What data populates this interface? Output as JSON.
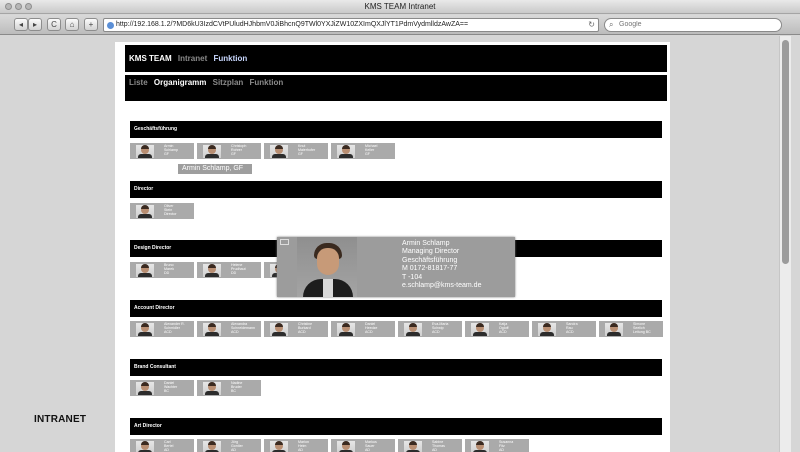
{
  "window": {
    "title": "KMS TEAM Intranet"
  },
  "toolbar": {
    "back": "◂",
    "forward": "▸",
    "reload": "C",
    "home": "⌂",
    "add": "+",
    "url": "http://192.168.1.2/?MD6kU3IzdCVtPUludHJhbmV0JiBhcnQ9TWl0YXJiZW10ZXImQXJlYT1PdmVydmlldzAwZA==",
    "search_placeholder": "Google"
  },
  "nav": {
    "brand": "KMS TEAM",
    "items": [
      "Intranet",
      "Funktion"
    ],
    "subitems": [
      "Liste",
      "Organigramm",
      "Sitzplan",
      "Funktion"
    ]
  },
  "sections": {
    "gf": "Geschäftsführung",
    "director": "Director",
    "design": "Design Director",
    "account": "Account Director",
    "brand": "Brand Consultant",
    "art": "Art Director"
  },
  "cards": {
    "gf": [
      [
        "Armin",
        "Schlamp",
        "GF"
      ],
      [
        "Christoph",
        "Rohrer",
        "GF"
      ],
      [
        "Knut",
        "Maierhofer",
        "GF"
      ],
      [
        "Michael",
        "Keller",
        "GF"
      ]
    ],
    "director": [
      [
        "Oliver",
        "Stein",
        "Director"
      ]
    ],
    "design": [
      [
        "Bruno",
        "Marek",
        "DD"
      ],
      [
        "Helene",
        "Prudhaut",
        "DD"
      ],
      [
        "",
        "",
        ""
      ],
      [
        "",
        "",
        ""
      ]
    ],
    "account": [
      [
        "Alexander R.",
        "Schmidler",
        "ACD"
      ],
      [
        "Alexandra",
        "Schneidemann",
        "ACD"
      ],
      [
        "Christine",
        "Burkard",
        "ACD"
      ],
      [
        "Daniel",
        "Heedze",
        "ACD"
      ],
      [
        "Eva-Maria",
        "Schwip",
        "ACD"
      ],
      [
        "Katja",
        "Ogloff",
        "ACD"
      ],
      [
        "Sandra",
        "Rau",
        "ACD"
      ],
      [
        "Simone",
        "Seelich",
        "Leitung BC"
      ]
    ],
    "brand": [
      [
        "Daniel",
        "Wachter",
        "BC"
      ],
      [
        "Nadine",
        "Bruder",
        "BC"
      ]
    ],
    "art": [
      [
        "Carl",
        "Bertel",
        "AD"
      ],
      [
        "Jörg",
        "Gontier",
        "AD"
      ],
      [
        "Marion",
        "Heim",
        "AD"
      ],
      [
        "Markus",
        "Sauer",
        "AD"
      ],
      [
        "Sabine",
        "Thomas",
        "AD"
      ],
      [
        "Susanna",
        "Fitz",
        "AD"
      ]
    ]
  },
  "tooltip": "Armin Schlamp, GF",
  "popup": {
    "name": "Armin Schlamp",
    "role": "Managing Director",
    "dept": "Geschäftsführung",
    "mobile": "M 0172-81817-77",
    "ext": "T -104",
    "email": "e.schlamp@kms-team.de"
  },
  "footer_label": "INTRANET",
  "colors": {
    "black_bar": "#000000",
    "card_grey": "#aaaaaa",
    "popup_grey": "#9c9c9c"
  }
}
